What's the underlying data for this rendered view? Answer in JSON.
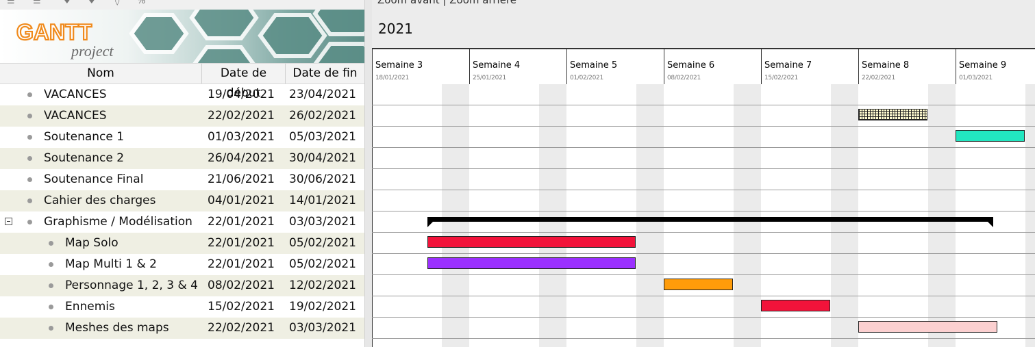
{
  "header": {
    "logo_main": "GANTT",
    "logo_sub": "project",
    "columns": {
      "name": "Nom",
      "start": "Date de début",
      "end": "Date de fin"
    }
  },
  "toolbar": {
    "zoom_text": "Zoom avant | Zoom arrière"
  },
  "timeline": {
    "year": "2021",
    "weeks": [
      {
        "label": "Semaine 3",
        "date": "18/01/2021"
      },
      {
        "label": "Semaine 4",
        "date": "25/01/2021"
      },
      {
        "label": "Semaine 5",
        "date": "01/02/2021"
      },
      {
        "label": "Semaine 6",
        "date": "08/02/2021"
      },
      {
        "label": "Semaine 7",
        "date": "15/02/2021"
      },
      {
        "label": "Semaine 8",
        "date": "22/02/2021"
      },
      {
        "label": "Semaine 9",
        "date": "01/03/2021"
      }
    ]
  },
  "tasks": [
    {
      "name": "VACANCES",
      "start": "19/04/2021",
      "end": "23/04/2021",
      "level": 0
    },
    {
      "name": "VACANCES",
      "start": "22/02/2021",
      "end": "26/02/2021",
      "level": 0,
      "color": "#fffbd0",
      "pattern": "grid"
    },
    {
      "name": "Soutenance 1",
      "start": "01/03/2021",
      "end": "05/03/2021",
      "level": 0,
      "color": "#22e6c0"
    },
    {
      "name": "Soutenance 2",
      "start": "26/04/2021",
      "end": "30/04/2021",
      "level": 0
    },
    {
      "name": "Soutenance Final",
      "start": "21/06/2021",
      "end": "30/06/2021",
      "level": 0
    },
    {
      "name": "Cahier des charges",
      "start": "04/01/2021",
      "end": "14/01/2021",
      "level": 0
    },
    {
      "name": "Graphisme / Modélisation",
      "start": "22/01/2021",
      "end": "03/03/2021",
      "level": 0,
      "summary": true,
      "expanded": true
    },
    {
      "name": "Map Solo",
      "start": "22/01/2021",
      "end": "05/02/2021",
      "level": 1,
      "color": "#f2133a"
    },
    {
      "name": "Map Multi 1 & 2",
      "start": "22/01/2021",
      "end": "05/02/2021",
      "level": 1,
      "color": "#9b30ff"
    },
    {
      "name": "Personnage 1, 2, 3 & 4",
      "start": "08/02/2021",
      "end": "12/02/2021",
      "level": 1,
      "color": "#ff9c0a"
    },
    {
      "name": "Ennemis",
      "start": "15/02/2021",
      "end": "19/02/2021",
      "level": 1,
      "color": "#f2133a"
    },
    {
      "name": "Meshes des maps",
      "start": "22/02/2021",
      "end": "03/03/2021",
      "level": 1,
      "color": "#fcd0d0"
    }
  ]
}
